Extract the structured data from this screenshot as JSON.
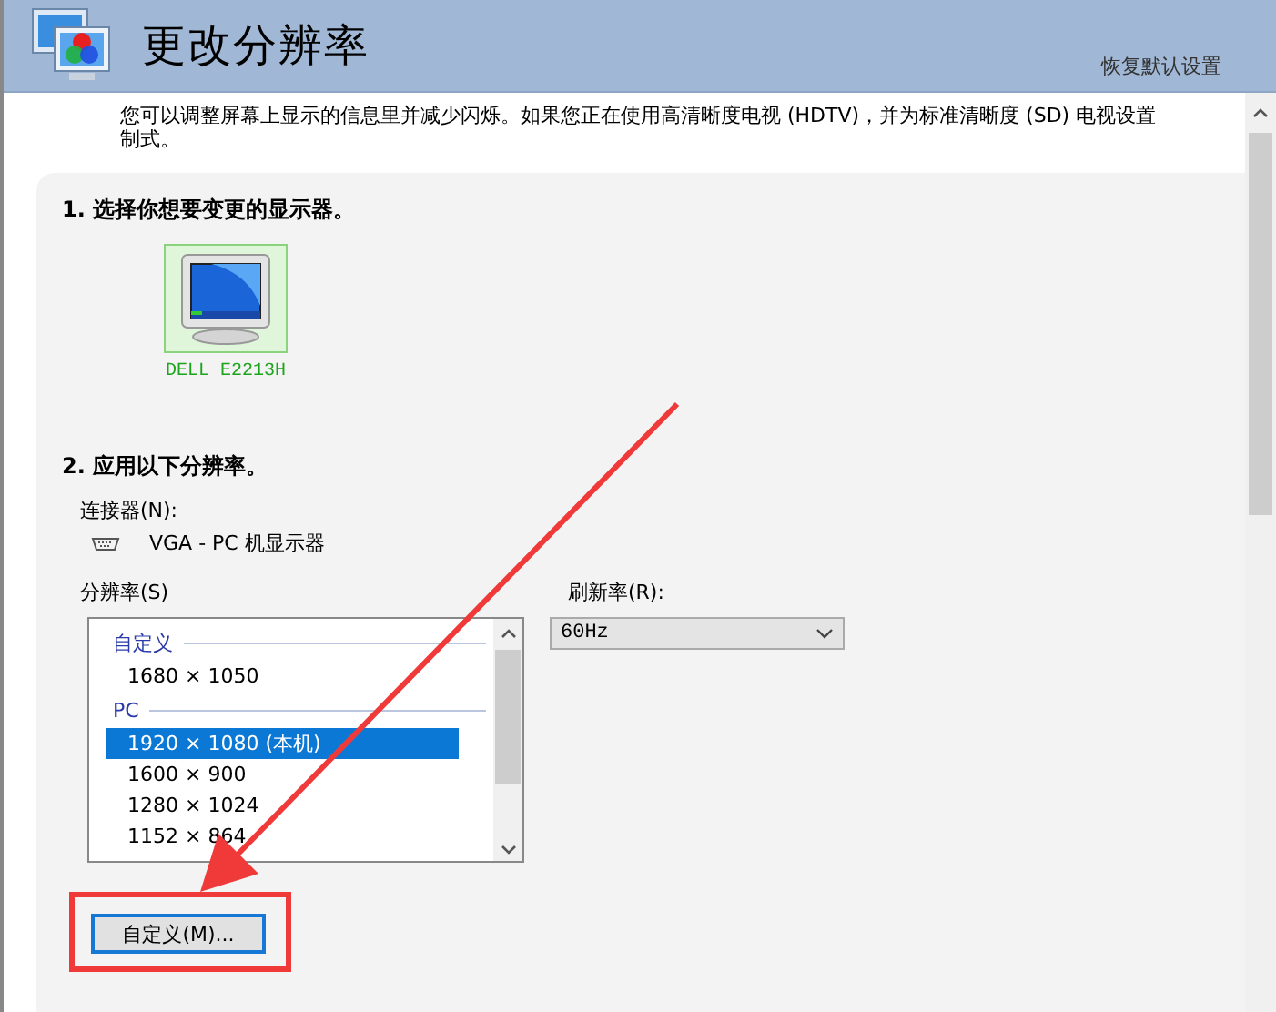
{
  "header": {
    "title": "更改分辨率",
    "restore_link": "恢复默认设置"
  },
  "description": "您可以调整屏幕上显示的信息里并减少闪烁。如果您正在使用高清晰度电视 (HDTV)，并为标准清晰度 (SD) 电视设置制式。",
  "step1": {
    "heading": "1. 选择你想要变更的显示器。",
    "displays": [
      {
        "name": "DELL E2213H",
        "selected": true
      }
    ]
  },
  "step2": {
    "heading": "2. 应用以下分辨率。",
    "connector_label": "连接器(N):",
    "connector": "VGA - PC 机显示器",
    "resolution_label": "分辨率(S)",
    "resolutions": [
      {
        "kind": "group",
        "text": "自定义"
      },
      {
        "kind": "item",
        "text": "1680 × 1050",
        "selected": false
      },
      {
        "kind": "group",
        "text": "PC"
      },
      {
        "kind": "item",
        "text": "1920 × 1080 (本机)",
        "selected": true
      },
      {
        "kind": "item",
        "text": "1600 × 900",
        "selected": false
      },
      {
        "kind": "item",
        "text": "1280 × 1024",
        "selected": false
      },
      {
        "kind": "item",
        "text": "1152 × 864",
        "selected": false
      }
    ],
    "refresh_label": "刷新率(R):",
    "refresh_value": "60Hz",
    "custom_button": "自定义(M)..."
  }
}
